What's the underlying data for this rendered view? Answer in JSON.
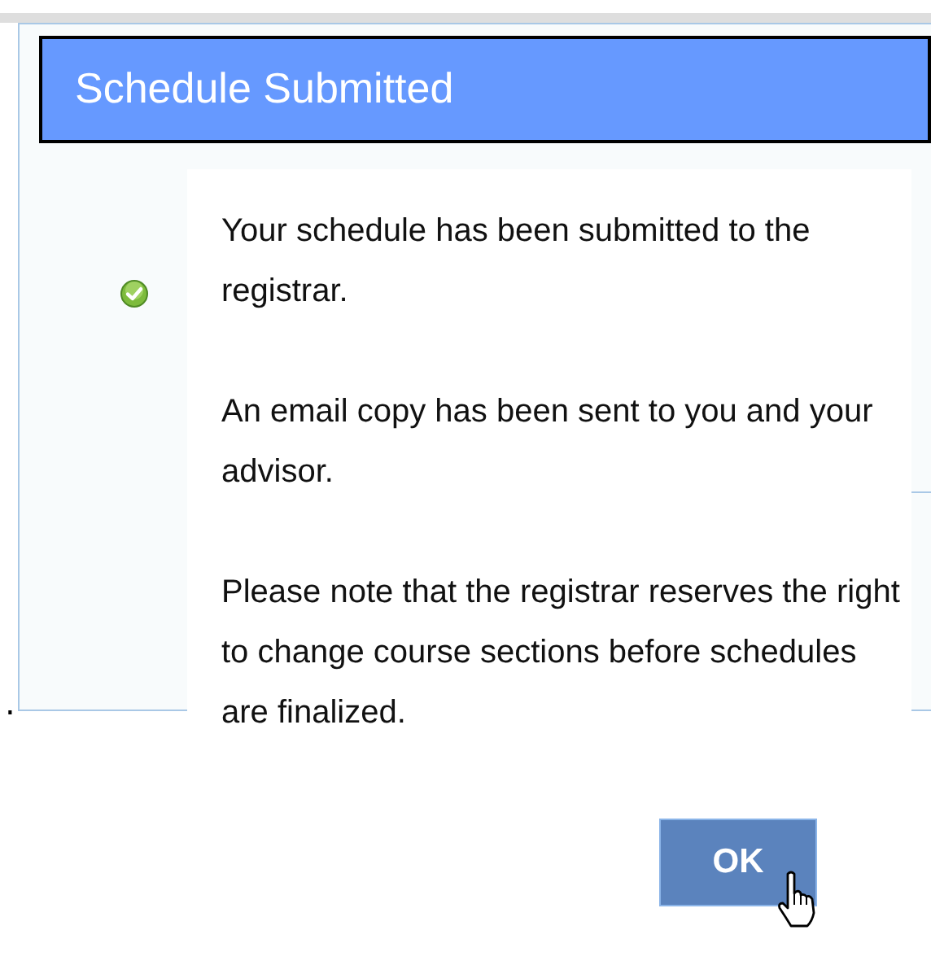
{
  "dialog": {
    "title": "Schedule Submitted",
    "paragraphs": [
      "Your schedule has been submitted to the registrar.",
      "An email copy has been sent to you and your advisor.",
      "Please note that the registrar reserves the right to change course sections before schedules are finalized."
    ],
    "ok_button": "OK"
  },
  "page_text": "."
}
